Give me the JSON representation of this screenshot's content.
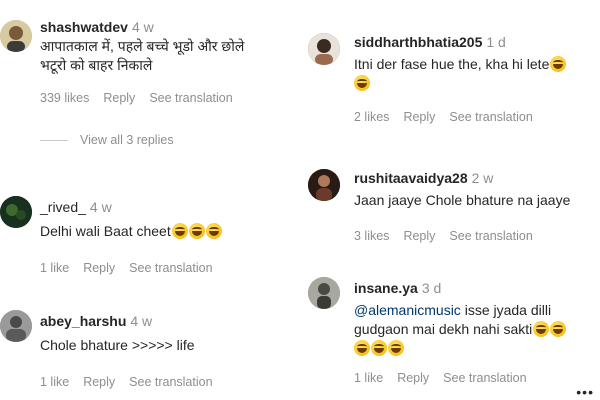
{
  "left_column": {
    "comments": [
      {
        "username": "shashwatdev",
        "time": "4 w",
        "text_lines": [
          "आपातकाल में, पहले बच्चे भूडो और छोले",
          "भटूरो को बाहर निकाले"
        ],
        "likes": "339 likes",
        "reply": "Reply",
        "translate": "See translation",
        "view_replies": "View all 3 replies",
        "avatar_color": "#c8b78a"
      },
      {
        "username": "_rived_",
        "time": "4 w",
        "text": "Delhi wali Baat cheet",
        "emoji": [
          "rolling-on-floor-laughing",
          "rolling-on-floor-laughing",
          "rolling-on-floor-laughing"
        ],
        "likes": "1 like",
        "reply": "Reply",
        "translate": "See translation",
        "avatar_color": "#1f3d2a"
      },
      {
        "username": "abey_harshu",
        "time": "4 w",
        "text": "Chole bhature >>>>> life",
        "likes": "1 like",
        "reply": "Reply",
        "translate": "See translation",
        "avatar_color": "#8a8a8a"
      }
    ]
  },
  "right_column": {
    "comments": [
      {
        "username": "siddharthbhatia205",
        "time": "1 d",
        "text_lines": [
          "Itni der fase hue the, kha hi lete"
        ],
        "emoji_inline": [
          "grinning-squinting"
        ],
        "emoji_line": [
          "grinning-squinting"
        ],
        "likes": "2 likes",
        "reply": "Reply",
        "translate": "See translation",
        "avatar_color": "#6b4a3a"
      },
      {
        "username": "rushitaavaidya28",
        "time": "2 w",
        "text": "Jaan jaaye Chole bhature na jaaye",
        "likes": "3 likes",
        "reply": "Reply",
        "translate": "See translation",
        "avatar_color": "#4a2e26"
      },
      {
        "username": "insane.ya",
        "time": "3 d",
        "mention": "@alemanicmusic",
        "text_after_mention": " isse jyada dilli",
        "text_line2": "gudgaon mai dekh nahi sakti",
        "emoji_inline": [
          "rolling-on-floor-laughing",
          "rolling-on-floor-laughing"
        ],
        "emoji_line": [
          "rolling-on-floor-laughing",
          "rolling-on-floor-laughing",
          "rolling-on-floor-laughing"
        ],
        "likes": "1 like",
        "reply": "Reply",
        "translate": "See translation",
        "more": "•••",
        "avatar_color": "#7a7a70"
      }
    ]
  }
}
